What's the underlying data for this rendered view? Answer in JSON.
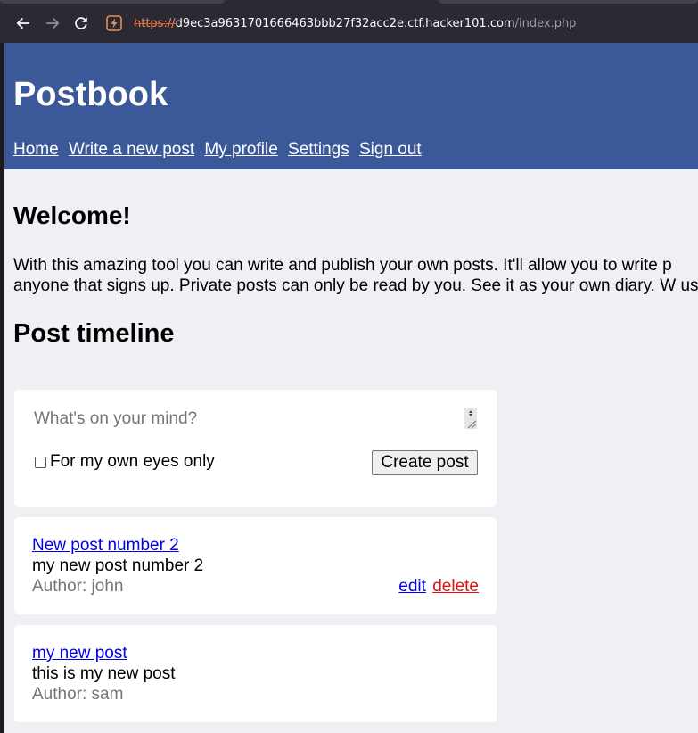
{
  "browser": {
    "url_scheme": "https://",
    "url_host": "d9ec3a9631701666463bbb27f32acc2e.ctf.hacker101.com",
    "url_path": "/index.php"
  },
  "header": {
    "brand": "Postbook",
    "nav": [
      "Home",
      "Write a new post",
      "My profile",
      "Settings",
      "Sign out"
    ]
  },
  "main": {
    "welcome_title": "Welcome!",
    "intro": "With this amazing tool you can write and publish your own posts. It'll allow you to write p anyone that signs up. Private posts can only be read by you. See it as your own diary. W us.",
    "timeline_title": "Post timeline"
  },
  "composer": {
    "placeholder": "What's on your mind?",
    "private_label": "For my own eyes only",
    "private_checked": false,
    "submit_label": "Create post"
  },
  "posts": [
    {
      "title": "New post number 2",
      "body": "my new post number 2",
      "author": "Author: john",
      "edit_label": "edit",
      "delete_label": "delete"
    },
    {
      "title": "my new post",
      "body": "this is my new post",
      "author": "Author: sam"
    }
  ]
}
